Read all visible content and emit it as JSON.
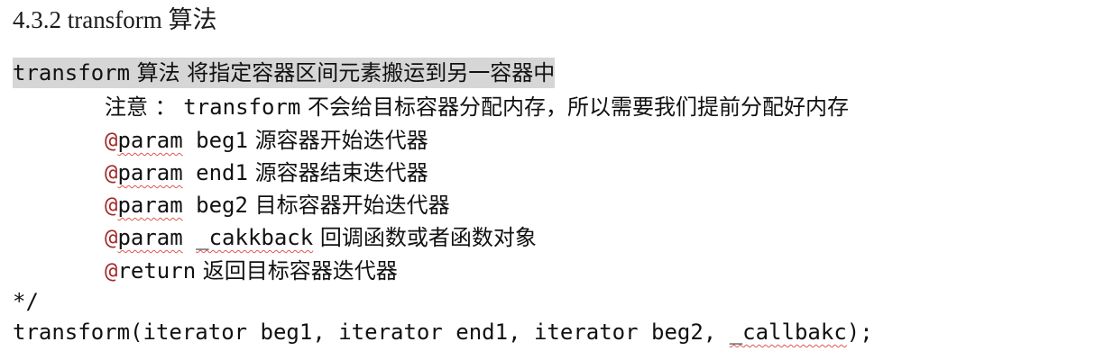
{
  "heading": "4.3.2 transform 算法",
  "summary": {
    "code": "transform",
    "text": " 算法 将指定容器区间元素搬运到另一容器中"
  },
  "note": {
    "label": "注意 ： ",
    "code": "transform",
    "text": " 不会给目标容器分配内存，所以需要我们提前分配好内存"
  },
  "params": [
    {
      "at": "@",
      "tag": "param",
      "name": "beg1",
      "desc": " 源容器开始迭代器"
    },
    {
      "at": "@",
      "tag": "param",
      "name": "end1",
      "desc": " 源容器结束迭代器"
    },
    {
      "at": "@",
      "tag": "param",
      "name": "beg2",
      "desc": " 目标容器开始迭代器"
    },
    {
      "at": "@",
      "tag": "param",
      "name": "_cakkback",
      "desc": " 回调函数或者函数对象"
    }
  ],
  "ret": {
    "at": "@",
    "tag": "return",
    "desc": " 返回目标容器迭代器"
  },
  "comment_end": "*/",
  "signature": {
    "prefix": "transform(iterator beg1, iterator end1, iterator beg2, ",
    "callback": "_callbakc",
    "suffix": ");"
  }
}
